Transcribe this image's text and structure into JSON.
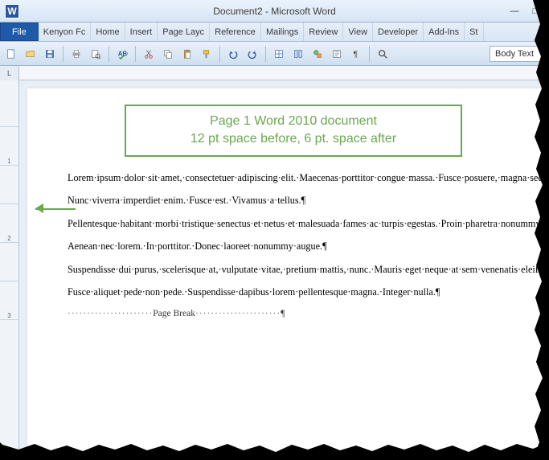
{
  "titlebar": {
    "app_glyph": "W",
    "title": "Document2 - Microsoft Word",
    "minimize": "—",
    "maximize": "□"
  },
  "tabs": {
    "file": "File",
    "list": [
      "Kenyon Fc",
      "Home",
      "Insert",
      "Page Layc",
      "Reference",
      "Mailings",
      "Review",
      "View",
      "Developer",
      "Add-Ins",
      "St"
    ]
  },
  "qat": {
    "style_selector": "Body Text"
  },
  "ruler_corner": "L",
  "ruler_v_labels": [
    "",
    "1",
    "",
    "2",
    "",
    "3"
  ],
  "callout": {
    "line1": "Page 1 Word 2010 document",
    "line2": "12 pt space before, 6 pt. space after"
  },
  "paragraphs": [
    "Lorem·ipsum·dolor·sit·amet,·consectetuer·adipiscing·elit.·Maecenas·porttitor·congue·massa.·Fusce·posuere,·magna·sed·pulvinar·ultricies,·purus·lectus·malesuada·libero,·sit·amet·commodo·magna·eros·quis·urna.¶",
    "Nunc·viverra·imperdiet·enim.·Fusce·est.·Vivamus·a·tellus.¶",
    "Pellentesque·habitant·morbi·tristique·senectus·et·netus·et·malesuada·fames·ac·turpis·egestas.·Proin·pharetra·nonummy·pede.·Mauris·et·orci.¶",
    "Aenean·nec·lorem.·In·porttitor.·Donec·laoreet·nonummy·augue.¶",
    "Suspendisse·dui·purus,·scelerisque·at,·vulputate·vitae,·pretium·mattis,·nunc.·Mauris·eget·neque·at·sem·venenatis·eleifend.·Ut·nonummy.¶",
    "Fusce·aliquet·pede·non·pede.·Suspendisse·dapibus·lorem·pellentesque·magna.·Integer·nulla.¶"
  ],
  "page_break": {
    "dots_left": "······················",
    "label": "Page Break",
    "dots_right": "······················",
    "pilcrow": "¶"
  }
}
